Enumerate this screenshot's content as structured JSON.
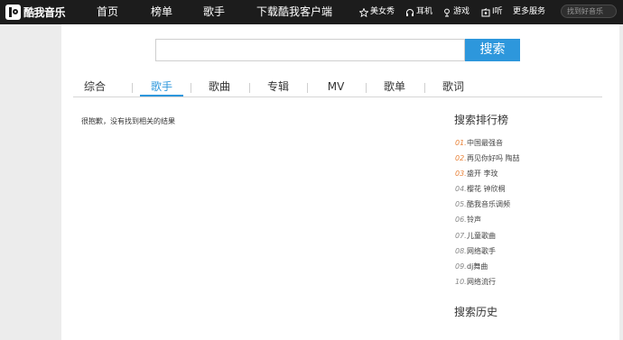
{
  "header": {
    "logo_text": "酷我音乐",
    "nav": [
      {
        "label": "首页"
      },
      {
        "label": "榜单"
      },
      {
        "label": "歌手"
      },
      {
        "label": "下载酷我客户端"
      }
    ],
    "side": [
      {
        "label": "美女秀",
        "icon": "star-icon"
      },
      {
        "label": "耳机",
        "icon": "headphones-icon"
      },
      {
        "label": "游戏",
        "icon": "game-icon"
      },
      {
        "label": "I听",
        "icon": "radio-icon"
      },
      {
        "label": "更多服务",
        "icon": ""
      }
    ],
    "search_placeholder": "找到好音乐"
  },
  "search": {
    "query": "",
    "button_label": "搜索"
  },
  "tabs": [
    {
      "label": "综合"
    },
    {
      "label": "歌手",
      "active": true
    },
    {
      "label": "歌曲"
    },
    {
      "label": "专辑"
    },
    {
      "label": "MV"
    },
    {
      "label": "歌单"
    },
    {
      "label": "歌词"
    }
  ],
  "results": {
    "empty_message": "很抱歉，没有找到相关的结果"
  },
  "ranking": {
    "title": "搜索排行榜",
    "items": [
      {
        "num": "01.",
        "text": "中国最强音"
      },
      {
        "num": "02.",
        "text": "再见你好吗 陶喆"
      },
      {
        "num": "03.",
        "text": "盛开 李玟"
      },
      {
        "num": "04.",
        "text": "樱花 钟欣桐"
      },
      {
        "num": "05.",
        "text": "酷我音乐调频"
      },
      {
        "num": "06.",
        "text": "铃声"
      },
      {
        "num": "07.",
        "text": "儿童歌曲"
      },
      {
        "num": "08.",
        "text": "网络歌手"
      },
      {
        "num": "09.",
        "text": "dj舞曲"
      },
      {
        "num": "10.",
        "text": "网络流行"
      }
    ]
  },
  "history": {
    "title": "搜索历史"
  },
  "colors": {
    "topbar": "#1c1c1c",
    "accent": "#2d97dc",
    "hot_rank": "#e8833a",
    "background": "#ececec"
  }
}
